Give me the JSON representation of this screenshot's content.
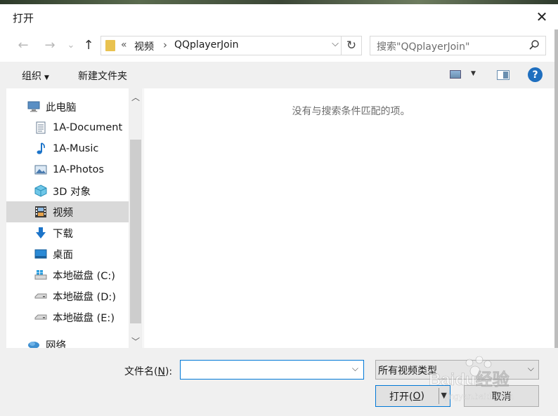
{
  "window": {
    "title": "打开",
    "close_glyph": "✕"
  },
  "address_bar": {
    "overflow": "«",
    "crumbs": [
      "视频",
      "QQplayerJoin"
    ],
    "separator": "›",
    "dropdown": "⌵",
    "refresh": "↻"
  },
  "search": {
    "placeholder": "搜索\"QQplayerJoin\""
  },
  "nav_buttons": {
    "back": "←",
    "forward": "→",
    "recent": "⌄",
    "up": "↑"
  },
  "toolbar": {
    "organize": "组织",
    "new_folder": "新建文件夹",
    "help": "?"
  },
  "nav_pane": {
    "items": [
      {
        "label": "此电脑",
        "icon": "computer-icon"
      },
      {
        "label": "1A-Document",
        "icon": "document-icon"
      },
      {
        "label": "1A-Music",
        "icon": "music-note-icon"
      },
      {
        "label": "1A-Photos",
        "icon": "picture-icon"
      },
      {
        "label": "3D 对象",
        "icon": "3d-cube-icon"
      },
      {
        "label": "视频",
        "icon": "film-icon",
        "selected": true
      },
      {
        "label": "下载",
        "icon": "download-arrow-icon"
      },
      {
        "label": "桌面",
        "icon": "desktop-icon"
      },
      {
        "label": "本地磁盘 (C:)",
        "icon": "windows-drive-icon"
      },
      {
        "label": "本地磁盘 (D:)",
        "icon": "drive-icon"
      },
      {
        "label": "本地磁盘 (E:)",
        "icon": "drive-icon"
      },
      {
        "label": "网络",
        "icon": "network-icon"
      }
    ]
  },
  "content": {
    "empty_message": "没有与搜索条件匹配的项。"
  },
  "footer": {
    "filename_label": "文件名(",
    "filename_key": "N",
    "filename_label_end": "):",
    "filename_value": "",
    "filetype_value": "所有视频类型",
    "open_label": "打开(",
    "open_key": "O",
    "open_label_end": ")",
    "cancel_label": "取消"
  },
  "watermark": {
    "text": "Baidu经验",
    "subtext": "jingyan.baidu.com"
  },
  "colors": {
    "accent": "#0078d7",
    "folder": "#e9c24f",
    "selected_bg": "#d9d9d9"
  }
}
